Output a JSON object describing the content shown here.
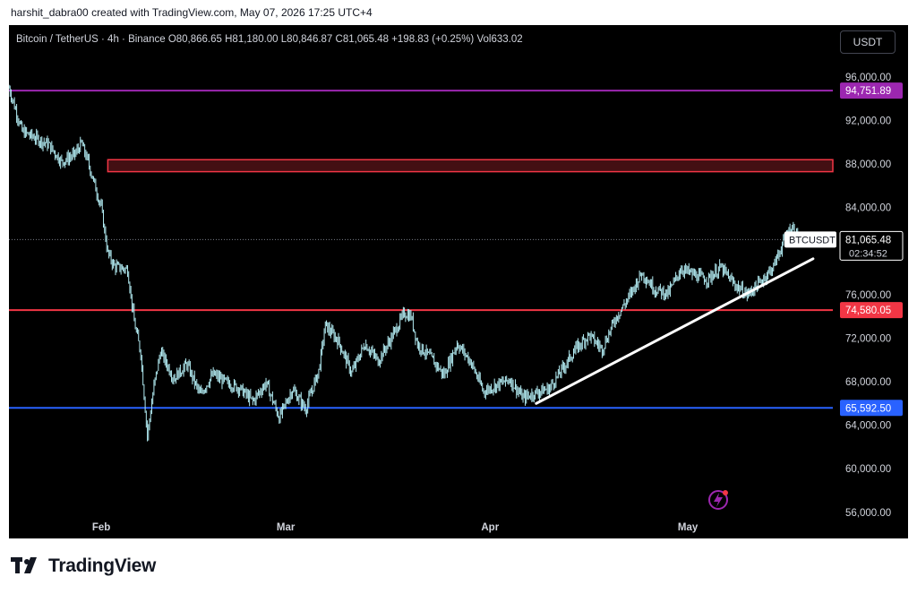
{
  "header": {
    "credit": "harshit_dabra00 created with TradingView.com, May 07, 2026 17:25 UTC+4"
  },
  "legend": {
    "text": "Bitcoin / TetherUS · 4h · Binance  O80,866.65  H81,180.00  L80,846.87  C81,065.48  +198.83 (+0.25%)  Vol633.02"
  },
  "currency_button": {
    "label": "USDT"
  },
  "brand": {
    "name": "TradingView",
    "logo_icon": "tradingview-logo-icon"
  },
  "chart_data": {
    "type": "candlestick",
    "symbol": "BTCUSDT",
    "last_price": "81,065.48",
    "countdown": "02:34:52",
    "x_ticks": [
      {
        "label": "Feb",
        "day": 22
      },
      {
        "label": "Mar",
        "day": 50
      },
      {
        "label": "Apr",
        "day": 81
      },
      {
        "label": "May",
        "day": 111
      }
    ],
    "x_range": [
      8,
      133
    ],
    "y_range": [
      55900,
      98300
    ],
    "y_ticks": [
      {
        "value": 96000,
        "label": "96,000.00"
      },
      {
        "value": 92000,
        "label": "92,000.00"
      },
      {
        "value": 88000,
        "label": "88,000.00"
      },
      {
        "value": 84000,
        "label": "84,000.00"
      },
      {
        "value": 76000,
        "label": "76,000.00"
      },
      {
        "value": 72000,
        "label": "72,000.00"
      },
      {
        "value": 68000,
        "label": "68,000.00"
      },
      {
        "value": 64000,
        "label": "64,000.00"
      },
      {
        "value": 60000,
        "label": "60,000.00"
      },
      {
        "value": 56000,
        "label": "56,000.00"
      }
    ],
    "levels": [
      {
        "value": 94751.89,
        "label": "94,751.89",
        "color": "#9c27b0"
      },
      {
        "value": 74580.05,
        "label": "74,580.05",
        "color": "#f23645"
      },
      {
        "value": 65592.5,
        "label": "65,592.50",
        "color": "#2962ff"
      }
    ],
    "zone": {
      "from": 87300,
      "to": 88400,
      "start_day": 23,
      "color": "#f23645"
    },
    "trendline": {
      "from": {
        "day": 88,
        "value": 66000
      },
      "to": {
        "day": 130,
        "value": 79300
      },
      "color": "#ffffff"
    },
    "price_path": [
      {
        "day": 8,
        "value": 95000
      },
      {
        "day": 10,
        "value": 91000
      },
      {
        "day": 12,
        "value": 90400
      },
      {
        "day": 14,
        "value": 89800
      },
      {
        "day": 16,
        "value": 88200
      },
      {
        "day": 18,
        "value": 88900
      },
      {
        "day": 19,
        "value": 89900
      },
      {
        "day": 20,
        "value": 88200
      },
      {
        "day": 22,
        "value": 84000
      },
      {
        "day": 23,
        "value": 79800
      },
      {
        "day": 24,
        "value": 78600
      },
      {
        "day": 26,
        "value": 78300
      },
      {
        "day": 27,
        "value": 73500
      },
      {
        "day": 28,
        "value": 70600
      },
      {
        "day": 29,
        "value": 63000
      },
      {
        "day": 30,
        "value": 67600
      },
      {
        "day": 31,
        "value": 70800
      },
      {
        "day": 33,
        "value": 68300
      },
      {
        "day": 35,
        "value": 69600
      },
      {
        "day": 37,
        "value": 66800
      },
      {
        "day": 39,
        "value": 68700
      },
      {
        "day": 41,
        "value": 67900
      },
      {
        "day": 43,
        "value": 67400
      },
      {
        "day": 45,
        "value": 66200
      },
      {
        "day": 47,
        "value": 67900
      },
      {
        "day": 49,
        "value": 64700
      },
      {
        "day": 51,
        "value": 67300
      },
      {
        "day": 53,
        "value": 65500
      },
      {
        "day": 55,
        "value": 69000
      },
      {
        "day": 56,
        "value": 73200
      },
      {
        "day": 58,
        "value": 71700
      },
      {
        "day": 60,
        "value": 68800
      },
      {
        "day": 62,
        "value": 71500
      },
      {
        "day": 64,
        "value": 69900
      },
      {
        "day": 66,
        "value": 72000
      },
      {
        "day": 68,
        "value": 74300
      },
      {
        "day": 69,
        "value": 74000
      },
      {
        "day": 70,
        "value": 71400
      },
      {
        "day": 72,
        "value": 70200
      },
      {
        "day": 74,
        "value": 68600
      },
      {
        "day": 76,
        "value": 71500
      },
      {
        "day": 78,
        "value": 69900
      },
      {
        "day": 80,
        "value": 67100
      },
      {
        "day": 82,
        "value": 67700
      },
      {
        "day": 84,
        "value": 68200
      },
      {
        "day": 86,
        "value": 66500
      },
      {
        "day": 88,
        "value": 67000
      },
      {
        "day": 90,
        "value": 67400
      },
      {
        "day": 92,
        "value": 69200
      },
      {
        "day": 94,
        "value": 71000
      },
      {
        "day": 96,
        "value": 72300
      },
      {
        "day": 98,
        "value": 71000
      },
      {
        "day": 100,
        "value": 73800
      },
      {
        "day": 102,
        "value": 75700
      },
      {
        "day": 104,
        "value": 78000
      },
      {
        "day": 106,
        "value": 76500
      },
      {
        "day": 108,
        "value": 76100
      },
      {
        "day": 110,
        "value": 78400
      },
      {
        "day": 112,
        "value": 77800
      },
      {
        "day": 114,
        "value": 77400
      },
      {
        "day": 116,
        "value": 78500
      },
      {
        "day": 118,
        "value": 77000
      },
      {
        "day": 120,
        "value": 76000
      },
      {
        "day": 122,
        "value": 77100
      },
      {
        "day": 124,
        "value": 78600
      },
      {
        "day": 126,
        "value": 81600
      },
      {
        "day": 127,
        "value": 82100
      },
      {
        "day": 128,
        "value": 81065
      }
    ],
    "colors": {
      "background": "#000000",
      "candle": "#b2ebf2",
      "axis_text": "#d1d4dc",
      "grid_dots": "#787b86",
      "alert_icon": "#9c27b0"
    }
  }
}
